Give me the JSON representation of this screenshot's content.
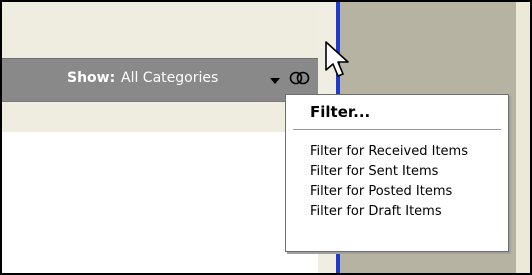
{
  "toolbar": {
    "show_label": "Show:",
    "show_value": "All Categories",
    "dropdown_icon": "chevron-down-icon",
    "filter_icon": "filter-icon"
  },
  "filter_menu": {
    "header": "Filter...",
    "items": [
      {
        "label": "Filter for Received Items"
      },
      {
        "label": "Filter for Sent Items"
      },
      {
        "label": "Filter for Posted Items"
      },
      {
        "label": "Filter for Draft Items"
      }
    ]
  },
  "colors": {
    "toolbar_bg": "#898989",
    "panel_bg": "#efece0",
    "divider_blue": "#1e3ccc",
    "right_panel": "#b7b3a3"
  },
  "cursor_icon": "mouse-pointer-icon"
}
